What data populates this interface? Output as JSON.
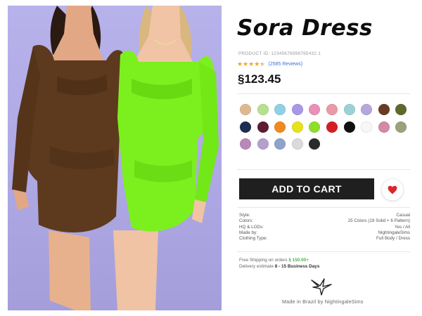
{
  "product": {
    "title": "Sora Dress",
    "product_id": "PRODUCT ID: 12345678998765432 1",
    "rating_stars": 4.5,
    "reviews": "(2585 Reviews)",
    "price": "§123.45"
  },
  "swatches": {
    "rows": [
      [
        "#dfb98e",
        "#b6e08e",
        "#8fd0e6",
        "#a898e6",
        "#e98fb8",
        "#e99aa6",
        "#9bd1d6",
        "#b5a7dd",
        "#6a3b24",
        "#5c6a2c"
      ],
      [
        "#1d2d52",
        "#5e1c33",
        "#f08a1e",
        "#e8e21a",
        "#8ddf27",
        "#d41f22",
        "#111111",
        "#f7f7f7",
        "#d38aa6",
        "#9aa27b"
      ],
      [
        "#b889b6",
        "#b3a0cc",
        "#8fa2c9",
        "#dadada",
        "#2b2b2b"
      ]
    ]
  },
  "actions": {
    "add_to_cart": "ADD TO CART"
  },
  "specs": [
    {
      "label": "Style:",
      "value": "Casual"
    },
    {
      "label": "Colors:",
      "value": "25 Colors (19 Solid + 6 Pattern)"
    },
    {
      "label": "HQ & LODs:",
      "value": "Yes / All"
    },
    {
      "label": "Made by:",
      "value": "NightingaleSims"
    },
    {
      "label": "Clothing Type:",
      "value": "Full Body / Dress"
    }
  ],
  "shipping": {
    "free_label": "Free Shipping on orders",
    "free_amount": "§ 150.00+",
    "delivery_label": "Delivery estimate",
    "delivery_value": "8 - 15 Business Days"
  },
  "footer": {
    "credit": "Made in Brazil by NightingaleSims"
  },
  "colors": {
    "photo_background": "#b0aae5",
    "brown_dress": "#5d3a1d",
    "green_dress": "#7cf01e",
    "heart": "#e0262c",
    "button": "#1f1f1f"
  }
}
